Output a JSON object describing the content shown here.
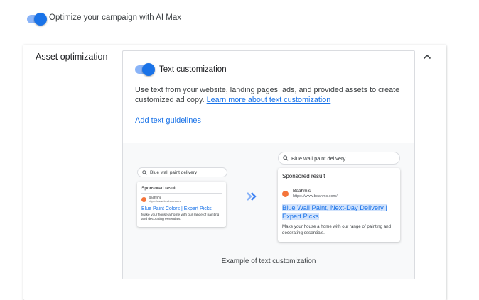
{
  "campaign": {
    "ai_max_label": "Optimize your campaign with AI Max",
    "ai_max_enabled": true
  },
  "asset_optimization": {
    "title": "Asset optimization",
    "collapse_icon": "chevron-up-icon",
    "text_customization": {
      "label": "Text customization",
      "enabled": true,
      "description": "Use text from your website, landing pages, ads, and provided assets to create customized ad copy. ",
      "learn_more": "Learn more about text customization",
      "add_guidelines": "Add text guidelines"
    },
    "example": {
      "before": {
        "query": "Blue wall paint delivery",
        "sponsored": "Sponsored result",
        "business": "Beahm's",
        "url": "https://www.beahms.com/",
        "headline": "Blue Paint Colors | Expert Picks",
        "text": "Make your house a home with our range of painting and decorating essentials."
      },
      "after": {
        "query": "Blue wall paint delivery",
        "sponsored": "Sponsored result",
        "business": "Beahm's",
        "url": "https://www.beahms.com/",
        "headline": "Blue Wall Paint, Next-Day Delivery | Expert Picks",
        "text": "Make your house a home with our range of painting and decorating essentials."
      },
      "caption": "Example of text customization"
    }
  },
  "colors": {
    "accent": "#1a73e8",
    "logo": "#f4753b",
    "highlight": "#d2e3fc",
    "preview_bg": "#f8f9fa"
  }
}
